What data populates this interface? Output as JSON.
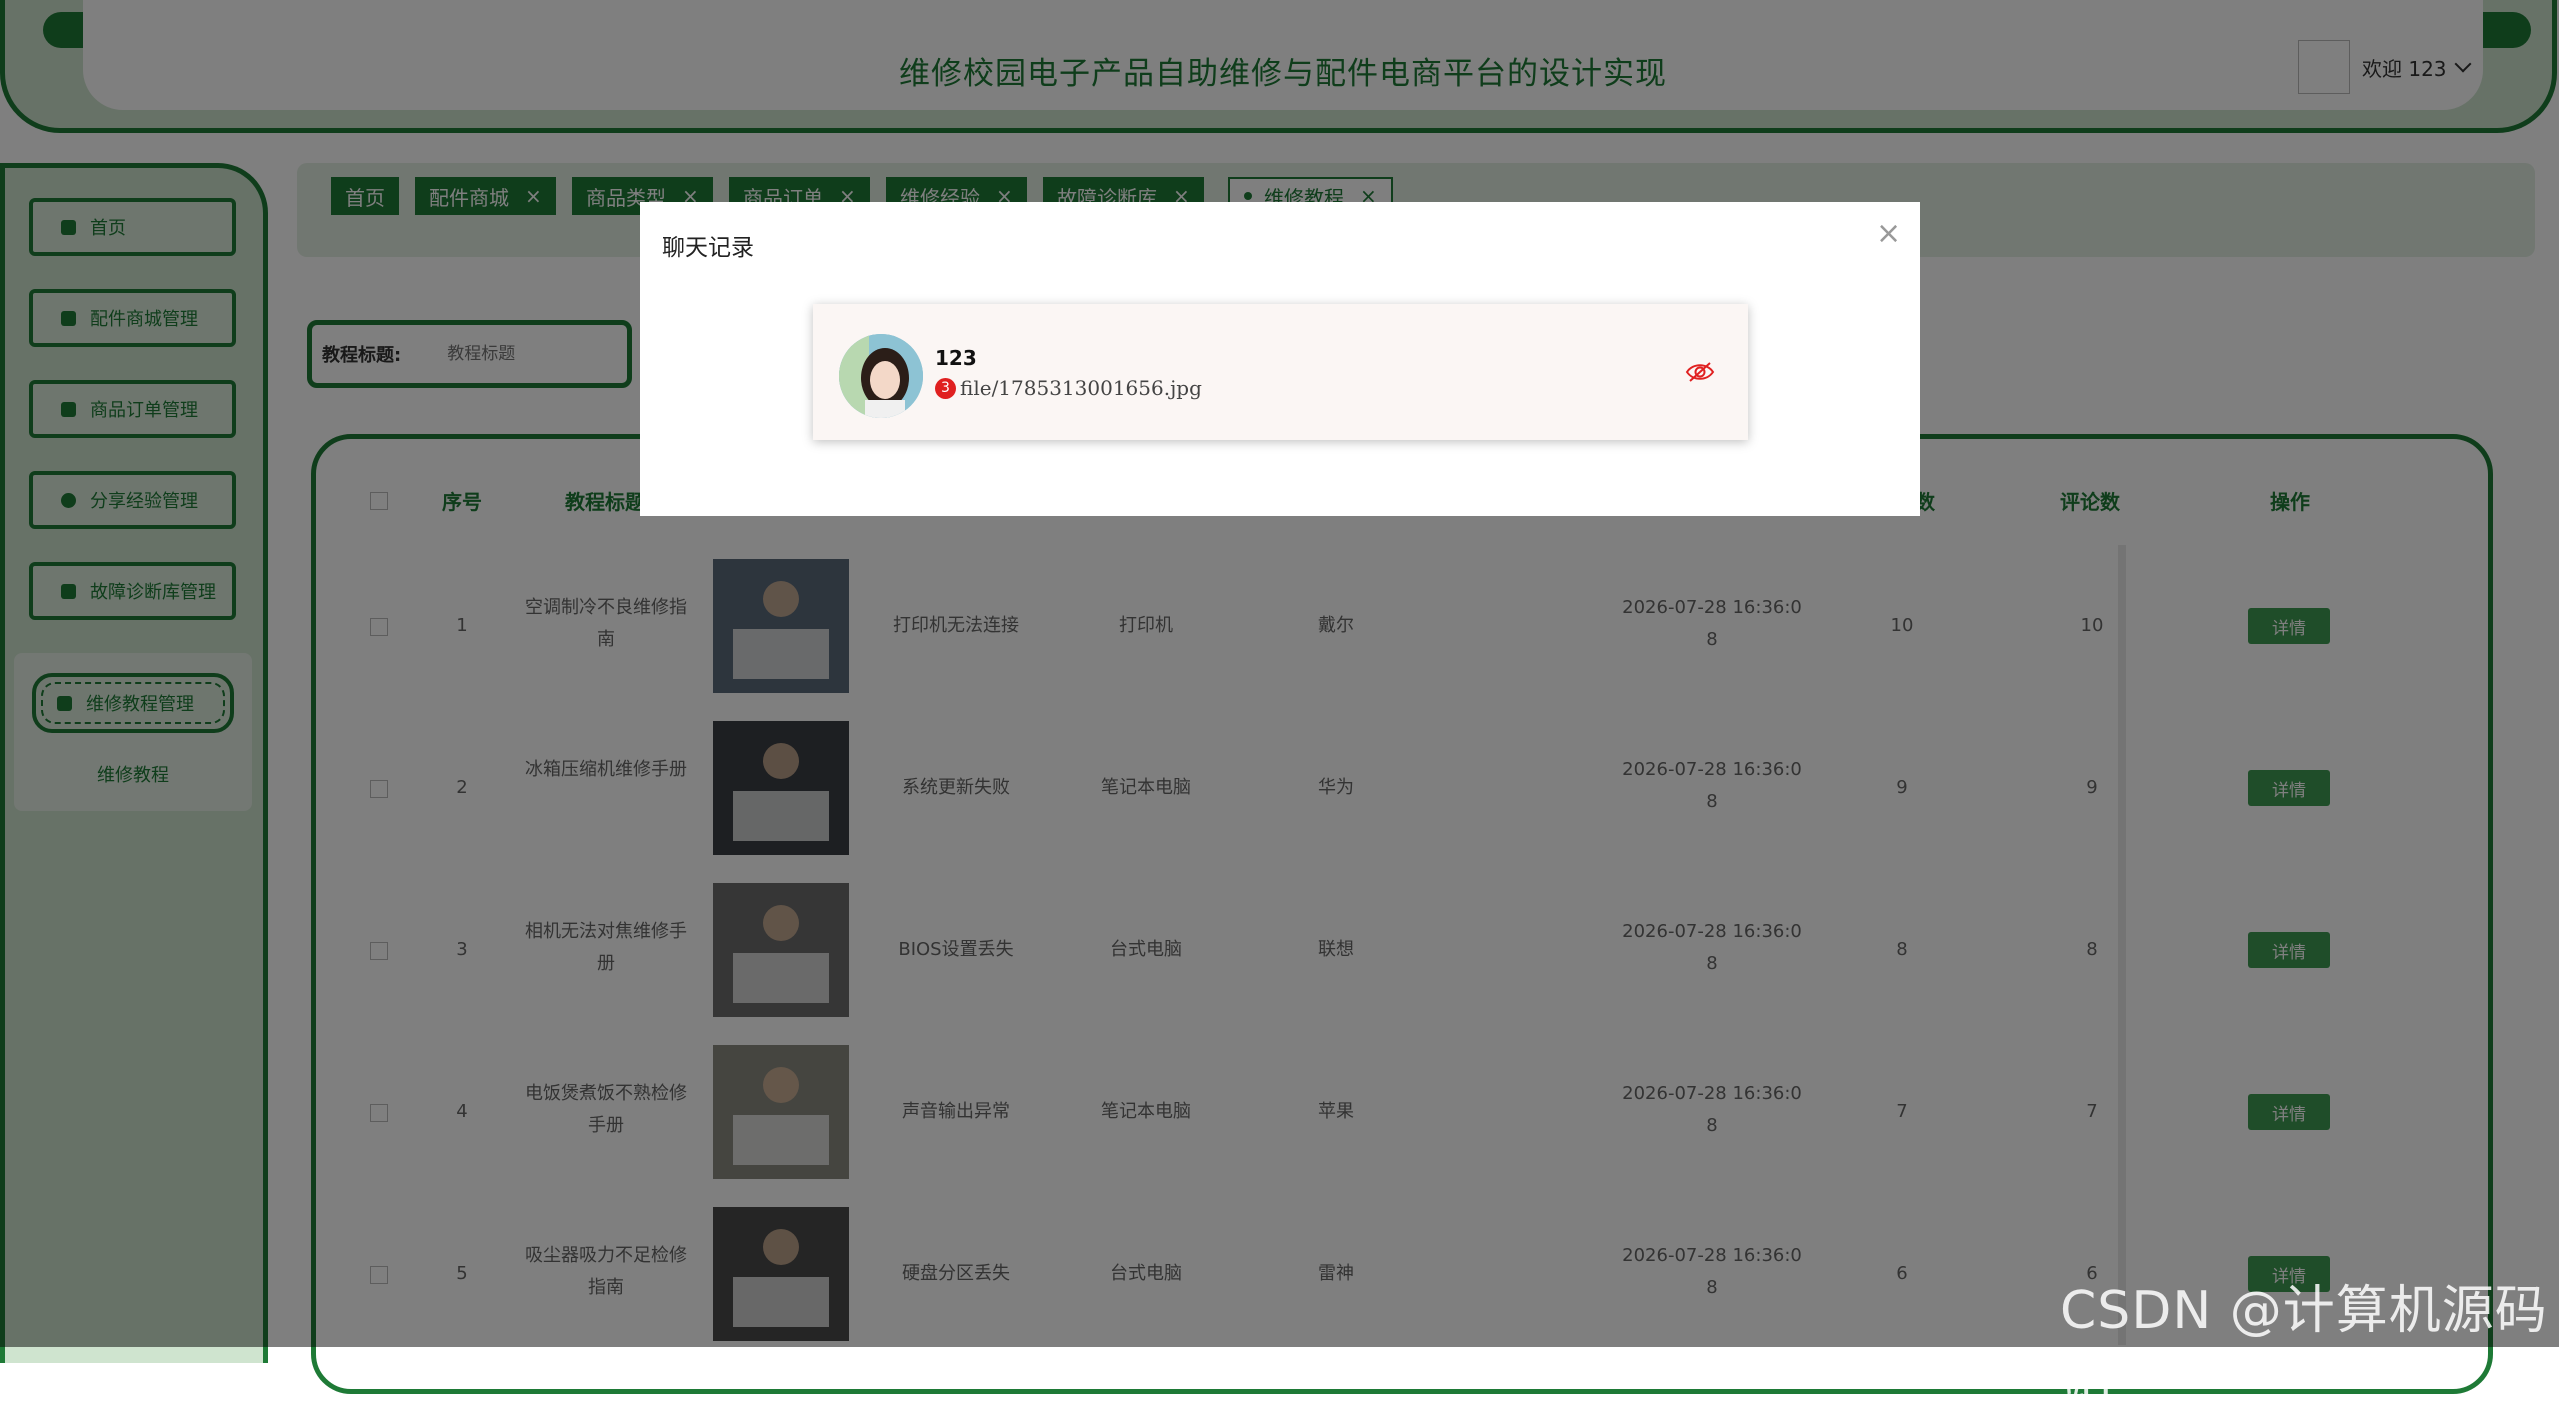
{
  "header": {
    "title": "维修校园电子产品自助维修与配件电商平台的设计实现",
    "welcome": "欢迎 123"
  },
  "sidebar": {
    "items": [
      {
        "label": "首页",
        "icon": "home-icon"
      },
      {
        "label": "配件商城管理",
        "icon": "store-icon"
      },
      {
        "label": "商品订单管理",
        "icon": "order-icon"
      },
      {
        "label": "分享经验管理",
        "icon": "share-icon"
      },
      {
        "label": "故障诊断库管理",
        "icon": "diagnose-icon"
      }
    ],
    "active": {
      "label": "维修教程管理",
      "sub": "维修教程"
    }
  },
  "tabs": [
    {
      "label": "首页"
    },
    {
      "label": "配件商城"
    },
    {
      "label": "商品类型"
    },
    {
      "label": "商品订单"
    },
    {
      "label": "维修经验"
    },
    {
      "label": "故障诊断库"
    },
    {
      "label": "维修教程"
    }
  ],
  "search": {
    "label": "教程标题:",
    "placeholder": "教程标题"
  },
  "table": {
    "headers": {
      "index": "序号",
      "title": "教程标题",
      "col_d": "数",
      "comments": "评论数",
      "ops": "操作"
    },
    "rows": [
      {
        "index": "1",
        "title": "空调制冷不良维修指南",
        "fault": "打印机无法连接",
        "device": "打印机",
        "brand": "戴尔",
        "time": "2026-07-28 16:36:08",
        "count": "10",
        "comments": "10",
        "action": "详情"
      },
      {
        "index": "2",
        "title": "冰箱压缩机维修手册",
        "fault": "系统更新失败",
        "device": "笔记本电脑",
        "brand": "华为",
        "time": "2026-07-28 16:36:08",
        "count": "9",
        "comments": "9",
        "action": "详情"
      },
      {
        "index": "3",
        "title": "相机无法对焦维修手册",
        "fault": "BIOS设置丢失",
        "device": "台式电脑",
        "brand": "联想",
        "time": "2026-07-28 16:36:08",
        "count": "8",
        "comments": "8",
        "action": "详情"
      },
      {
        "index": "4",
        "title": "电饭煲煮饭不熟检修手册",
        "fault": "声音输出异常",
        "device": "笔记本电脑",
        "brand": "苹果",
        "time": "2026-07-28 16:36:08",
        "count": "7",
        "comments": "7",
        "action": "详情"
      },
      {
        "index": "5",
        "title": "吸尘器吸力不足检修指南",
        "fault": "硬盘分区丢失",
        "device": "台式电脑",
        "brand": "雷神",
        "time": "2026-07-28 16:36:08",
        "count": "6",
        "comments": "6",
        "action": "详情"
      }
    ]
  },
  "modal": {
    "title": "聊天记录",
    "close": "×",
    "chat": {
      "name": "123",
      "badge": "3",
      "message": "file/1785313001656.jpg"
    }
  },
  "watermark": "CSDN @计算机源码站",
  "colors": {
    "primary": "#1e7a36",
    "light": "#cfe4cf",
    "badge": "#e02020"
  }
}
